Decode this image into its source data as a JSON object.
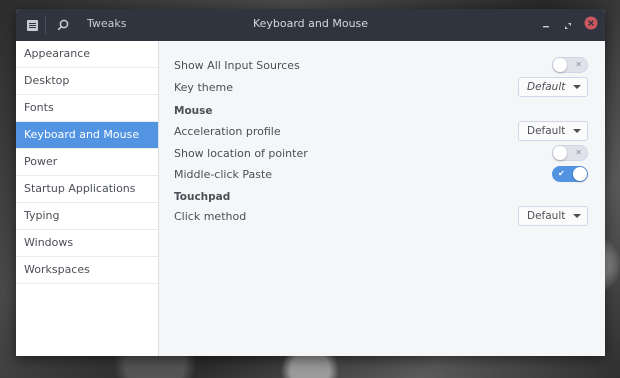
{
  "app": {
    "name": "Tweaks",
    "window_title": "Keyboard and Mouse"
  },
  "sidebar": {
    "items": [
      {
        "label": "Appearance",
        "selected": false
      },
      {
        "label": "Desktop",
        "selected": false
      },
      {
        "label": "Fonts",
        "selected": false
      },
      {
        "label": "Keyboard and Mouse",
        "selected": true
      },
      {
        "label": "Power",
        "selected": false
      },
      {
        "label": "Startup Applications",
        "selected": false
      },
      {
        "label": "Typing",
        "selected": false
      },
      {
        "label": "Windows",
        "selected": false
      },
      {
        "label": "Workspaces",
        "selected": false
      }
    ]
  },
  "settings": {
    "show_all_input_sources": {
      "label": "Show All Input Sources",
      "enabled": false,
      "glyph": "✕"
    },
    "key_theme": {
      "label": "Key theme",
      "value": "Default"
    },
    "mouse_section": "Mouse",
    "acceleration_profile": {
      "label": "Acceleration profile",
      "value": "Default"
    },
    "show_location_of_pointer": {
      "label": "Show location of pointer",
      "enabled": false,
      "glyph": "✕"
    },
    "middle_click_paste": {
      "label": "Middle-click Paste",
      "enabled": true,
      "glyph": "✔"
    },
    "touchpad_section": "Touchpad",
    "click_method": {
      "label": "Click method",
      "value": "Default"
    }
  },
  "colors": {
    "accent": "#5294e2",
    "titlebar": "#2f343f",
    "content_bg": "#f5f6f7"
  }
}
